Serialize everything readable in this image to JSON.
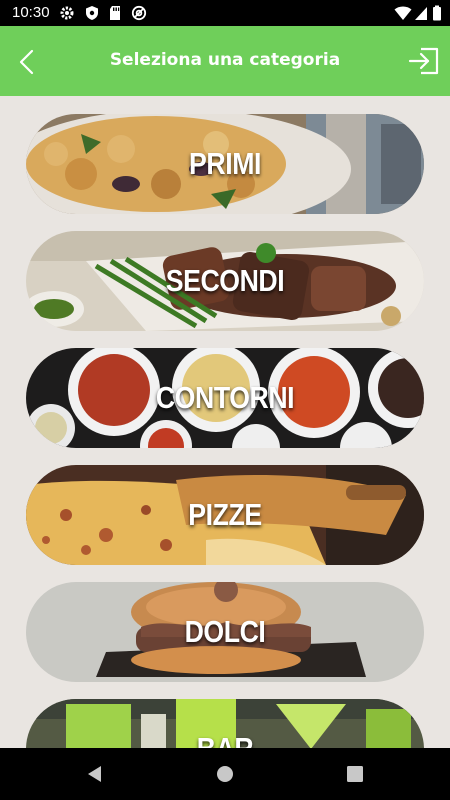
{
  "status_bar": {
    "time": "10:30",
    "left_icons": [
      "gear-icon",
      "shield-icon",
      "sd-card-icon",
      "at-sign-icon"
    ],
    "right_icons": [
      "wifi-icon",
      "cell-signal-icon",
      "battery-icon"
    ]
  },
  "header": {
    "title": "Seleziona una categoria",
    "back_icon": "chevron-left-icon",
    "logout_icon": "login-arrow-icon",
    "background_color": "#6fcf5a"
  },
  "categories": [
    {
      "label": "PRIMI"
    },
    {
      "label": "SECONDI"
    },
    {
      "label": "CONTORNI"
    },
    {
      "label": "PIZZE"
    },
    {
      "label": "DOLCI"
    },
    {
      "label": "BAR"
    }
  ],
  "nav_bar": {
    "icons": [
      "back-triangle-icon",
      "home-circle-icon",
      "recents-square-icon"
    ]
  }
}
